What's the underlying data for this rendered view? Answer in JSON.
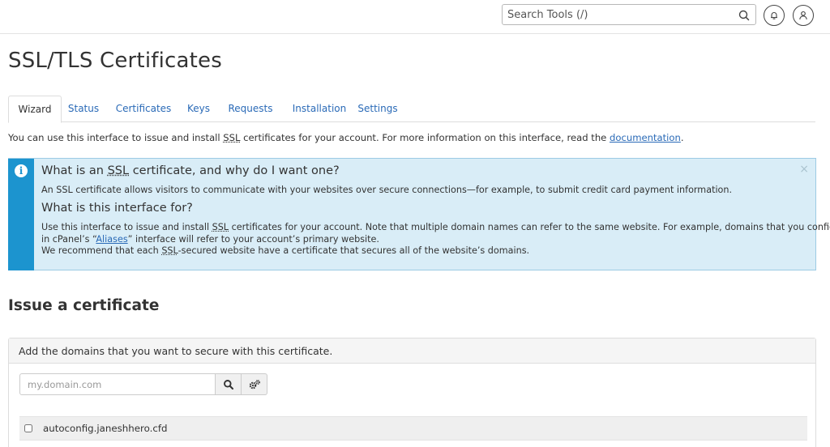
{
  "search": {
    "placeholder": "Search Tools (/)"
  },
  "title": "SSL/TLS Certificates",
  "tabs": [
    {
      "label": "Wizard"
    },
    {
      "label": "Status"
    },
    {
      "label": "Certificates"
    },
    {
      "label": "Keys"
    },
    {
      "label": "Requests"
    },
    {
      "label": "Installation"
    },
    {
      "label": "Settings"
    }
  ],
  "intro": {
    "before": "You can use this interface to issue and install ",
    "ssl": "SSL",
    "after": " certificates for your account. For more information on this interface, read the ",
    "link": "documentation",
    "end": "."
  },
  "info": {
    "heading1_before": "What is an ",
    "heading1_abbr": "SSL",
    "heading1_after": " certificate, and why do I want one?",
    "body1": "An SSL certificate allows visitors to communicate with your websites over secure connections—for example, to submit credit card payment information.",
    "heading2": "What is this interface for?",
    "line1_before": "Use this interface to issue and install ",
    "line1_abbr": "SSL",
    "line1_after": " certificates for your account. Note that multiple domain names can refer to the same website. For example, domains that you configure",
    "line2_before": "in cPanel’s “",
    "line2_link": "Aliases",
    "line2_after": "” interface will refer to your account’s primary website.",
    "line3_before": "We recommend that each ",
    "line3_abbr": "SSL",
    "line3_after": "-secured website have a certificate that secures all of the website’s domains.",
    "close": "×"
  },
  "issue": {
    "title": "Issue a certificate",
    "panel_heading": "Add the domains that you want to secure with this certificate.",
    "input_placeholder": "my.domain.com",
    "domains": [
      "autoconfig.janeshhero.cfd"
    ]
  },
  "colors": {
    "accent": "#2a6ab7",
    "info_bar": "#1c94cf",
    "info_bg": "#d9edf7"
  }
}
